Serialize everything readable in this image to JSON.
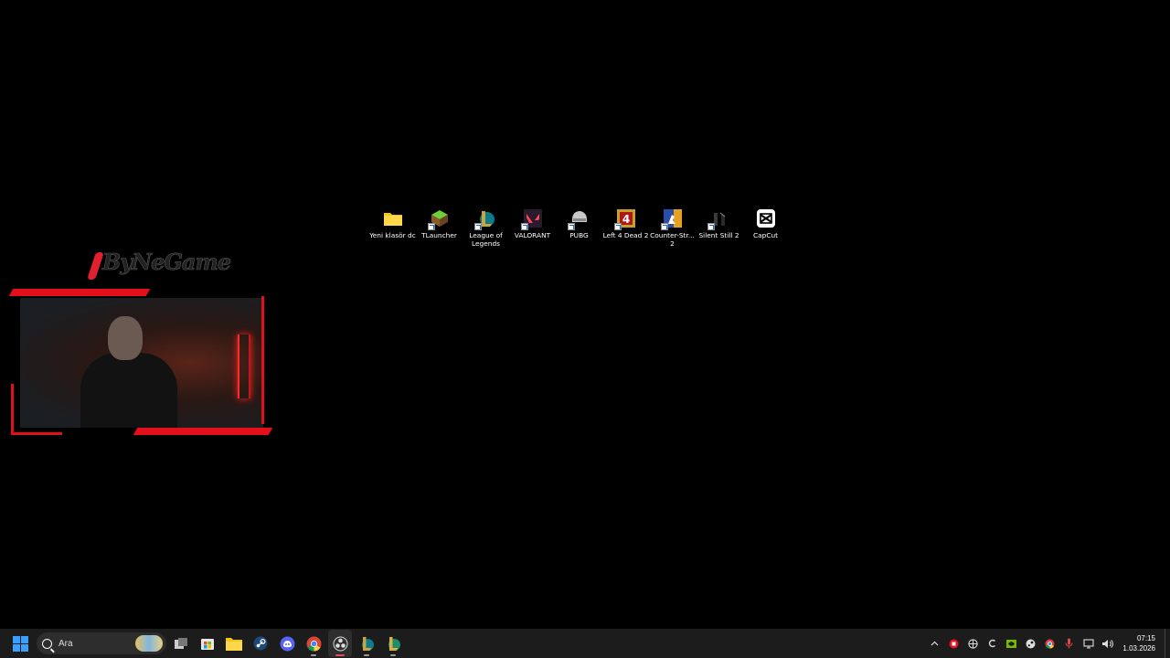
{
  "desktop": {
    "icons": [
      {
        "label": "Yeni klasör dc",
        "icon": "folder-icon"
      },
      {
        "label": "TLauncher",
        "icon": "tlauncher-icon"
      },
      {
        "label": "League of Legends",
        "icon": "league-of-legends-icon"
      },
      {
        "label": "VALORANT",
        "icon": "valorant-icon"
      },
      {
        "label": "PUBG",
        "icon": "pubg-icon"
      },
      {
        "label": "Left 4 Dead 2",
        "icon": "left4dead2-icon"
      },
      {
        "label": "Counter-Str... 2",
        "icon": "counter-strike-icon"
      },
      {
        "label": "Silent Still 2",
        "icon": "silent-still-icon"
      },
      {
        "label": "CapCut",
        "icon": "capcut-icon"
      }
    ]
  },
  "overlay": {
    "brand_text": "ByNeGame",
    "brand_color": "#e3101c"
  },
  "taskbar": {
    "search_placeholder": "Ara",
    "apps": [
      {
        "name": "task-view",
        "icon": "task-view-icon"
      },
      {
        "name": "microsoft-store",
        "icon": "store-icon"
      },
      {
        "name": "file-explorer",
        "icon": "folder-icon"
      },
      {
        "name": "steam",
        "icon": "steam-icon"
      },
      {
        "name": "discord",
        "icon": "discord-icon"
      },
      {
        "name": "chrome",
        "icon": "chrome-icon"
      },
      {
        "name": "obs",
        "icon": "obs-icon"
      },
      {
        "name": "league-client",
        "icon": "league-icon"
      },
      {
        "name": "league-client-2",
        "icon": "league-icon"
      }
    ],
    "tray": {
      "time": "07:15",
      "date": "1.03.2026"
    }
  },
  "colors": {
    "accent_blue": "#3aa0ff",
    "taskbar_bg": "#1c1c1c"
  }
}
